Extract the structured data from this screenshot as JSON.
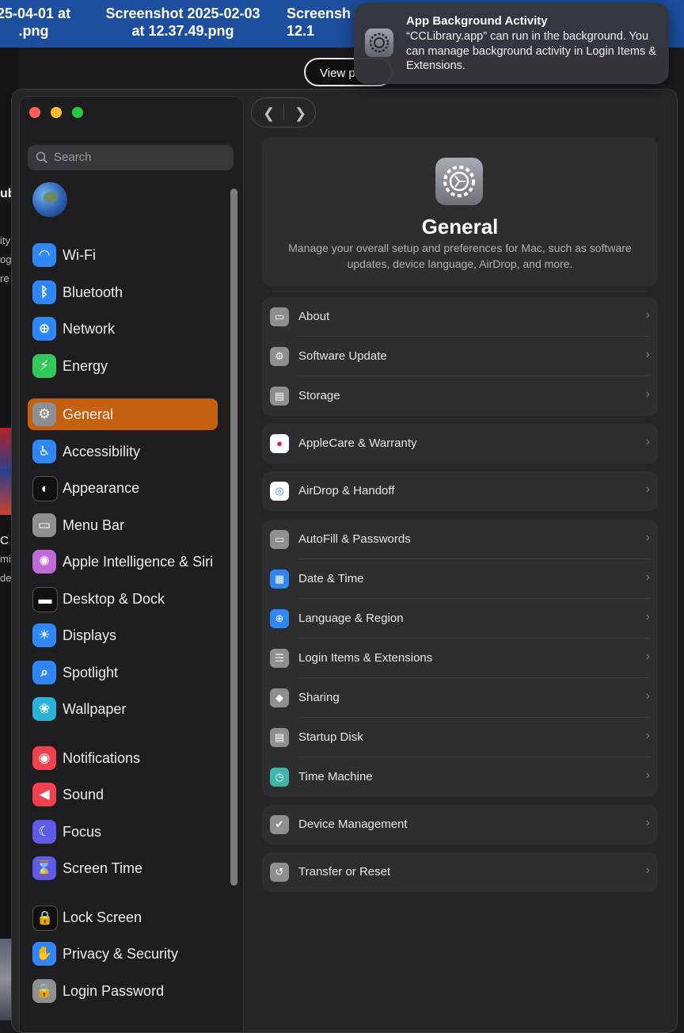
{
  "background": {
    "screenshots": [
      "25-04-01 at\n.png",
      "Screenshot 2025-02-03\nat 12.37.49.png",
      "Screensh\n12.1"
    ],
    "view_button_label": "View p",
    "left_fragments": [
      "ub",
      "ity",
      "ogo",
      "re",
      "C",
      "mi",
      "de"
    ]
  },
  "notification": {
    "title": "App Background Activity",
    "body": "“CCLibrary.app” can run in the background. You can manage background activity in Login Items & Extensions."
  },
  "window": {
    "search_placeholder": "Search",
    "sidebar": [
      {
        "label": "Wi-Fi",
        "icon": "wifi-icon",
        "color": "#2f86f5",
        "glyph": "◠"
      },
      {
        "label": "Bluetooth",
        "icon": "bluetooth-icon",
        "color": "#2f86f5",
        "glyph": "ᛒ"
      },
      {
        "label": "Network",
        "icon": "globe-icon",
        "color": "#2f86f5",
        "glyph": "⊕"
      },
      {
        "label": "Energy",
        "icon": "bolt-icon",
        "color": "#34c759",
        "glyph": "⚡"
      },
      {
        "label": "General",
        "icon": "gear-icon",
        "color": "#8e8e93",
        "glyph": "⚙",
        "selected": true
      },
      {
        "label": "Accessibility",
        "icon": "accessibility-icon",
        "color": "#2f86f5",
        "glyph": "♿"
      },
      {
        "label": "Appearance",
        "icon": "appearance-icon",
        "color": "#111111",
        "glyph": "◐"
      },
      {
        "label": "Menu Bar",
        "icon": "menu-bar-icon",
        "color": "#8e8e93",
        "glyph": "▭"
      },
      {
        "label": "Apple Intelligence & Siri",
        "icon": "siri-icon",
        "color": "#c06ad8",
        "glyph": "✺"
      },
      {
        "label": "Desktop & Dock",
        "icon": "dock-icon",
        "color": "#111111",
        "glyph": "▬"
      },
      {
        "label": "Displays",
        "icon": "displays-icon",
        "color": "#2f86f5",
        "glyph": "☀"
      },
      {
        "label": "Spotlight",
        "icon": "spotlight-icon",
        "color": "#2f86f5",
        "glyph": "⌕"
      },
      {
        "label": "Wallpaper",
        "icon": "wallpaper-icon",
        "color": "#2ab3d9",
        "glyph": "❀"
      },
      {
        "label": "Notifications",
        "icon": "notifications-icon",
        "color": "#f0424e",
        "glyph": "◉"
      },
      {
        "label": "Sound",
        "icon": "sound-icon",
        "color": "#f0424e",
        "glyph": "◀"
      },
      {
        "label": "Focus",
        "icon": "focus-icon",
        "color": "#5e5ce6",
        "glyph": "☾"
      },
      {
        "label": "Screen Time",
        "icon": "hourglass-icon",
        "color": "#5e5ce6",
        "glyph": "⌛"
      },
      {
        "label": "Lock Screen",
        "icon": "lock-screen-icon",
        "color": "#111111",
        "glyph": "🔒"
      },
      {
        "label": "Privacy & Security",
        "icon": "hand-icon",
        "color": "#2f86f5",
        "glyph": "✋"
      },
      {
        "label": "Login Password",
        "icon": "lock-icon",
        "color": "#8e8e93",
        "glyph": "🔒"
      }
    ],
    "hero": {
      "title": "General",
      "description": "Manage your overall setup and preferences for Mac, such as software updates, device language, AirDrop, and more."
    },
    "groups": [
      [
        {
          "label": "About",
          "icon": "about-icon",
          "color": "#8e8e93",
          "glyph": "▭"
        },
        {
          "label": "Software Update",
          "icon": "software-update-icon",
          "color": "#8e8e93",
          "glyph": "⚙"
        },
        {
          "label": "Storage",
          "icon": "storage-icon",
          "color": "#8e8e93",
          "glyph": "▤"
        }
      ],
      [
        {
          "label": "AppleCare & Warranty",
          "icon": "applecare-icon",
          "color": "#ffffff",
          "glyph": "●",
          "glyph_color": "#e3213b"
        }
      ],
      [
        {
          "label": "AirDrop & Handoff",
          "icon": "airdrop-icon",
          "color": "#ffffff",
          "glyph": "◎",
          "glyph_color": "#2f86f5"
        }
      ],
      [
        {
          "label": "AutoFill & Passwords",
          "icon": "autofill-icon",
          "color": "#8e8e93",
          "glyph": "▭"
        },
        {
          "label": "Date & Time",
          "icon": "calendar-icon",
          "color": "#2f86f5",
          "glyph": "▦"
        },
        {
          "label": "Language & Region",
          "icon": "globe-icon",
          "color": "#2f86f5",
          "glyph": "⊕"
        },
        {
          "label": "Login Items & Extensions",
          "icon": "list-icon",
          "color": "#8e8e93",
          "glyph": "☰"
        },
        {
          "label": "Sharing",
          "icon": "sharing-icon",
          "color": "#8e8e93",
          "glyph": "◆"
        },
        {
          "label": "Startup Disk",
          "icon": "disk-icon",
          "color": "#8e8e93",
          "glyph": "▤"
        },
        {
          "label": "Time Machine",
          "icon": "time-machine-icon",
          "color": "#3fb6a8",
          "glyph": "◷"
        }
      ],
      [
        {
          "label": "Device Management",
          "icon": "device-management-icon",
          "color": "#8e8e93",
          "glyph": "✔"
        }
      ],
      [
        {
          "label": "Transfer or Reset",
          "icon": "reset-icon",
          "color": "#8e8e93",
          "glyph": "↺"
        }
      ]
    ]
  }
}
